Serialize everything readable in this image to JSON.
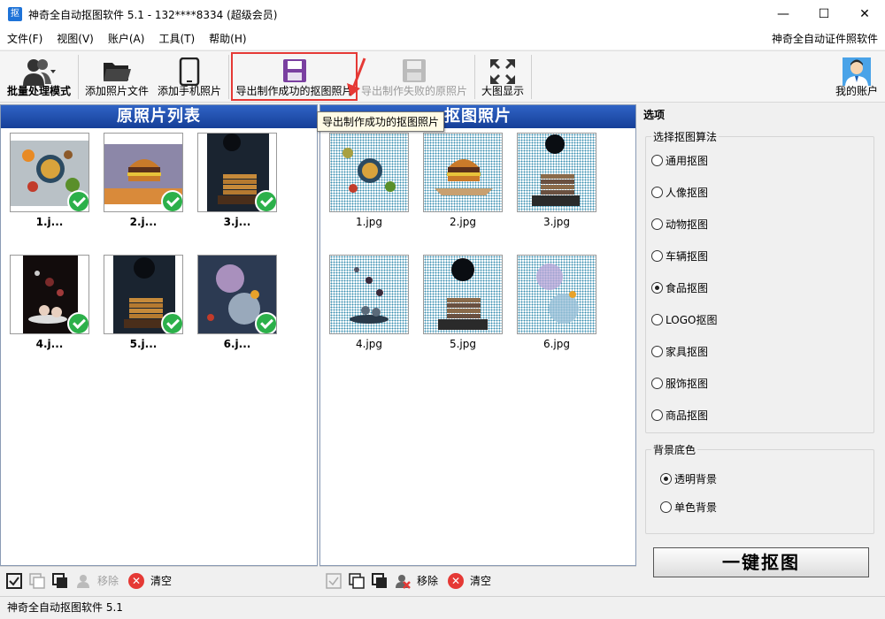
{
  "window": {
    "icon_text": "抠",
    "title": "神奇全自动抠图软件 5.1 - 132****8334 (超级会员)",
    "min": "—",
    "max": "☐",
    "close": "✕"
  },
  "menu": {
    "items": [
      "文件(F)",
      "视图(V)",
      "账户(A)",
      "工具(T)",
      "帮助(H)"
    ],
    "right_link": "神奇全自动证件照软件"
  },
  "toolbar": {
    "batch": "批量处理模式",
    "add_file": "添加照片文件",
    "add_phone": "添加手机照片",
    "export_success": "导出制作成功的抠图照片",
    "export_failed": "导出制作失败的原照片",
    "big_view": "大图显示",
    "account": "我的账户"
  },
  "tooltip": "导出制作成功的抠图照片",
  "left_panel": {
    "title": "原照片列表",
    "items": [
      "1.j...",
      "2.j...",
      "3.j...",
      "4.j...",
      "5.j...",
      "6.j..."
    ]
  },
  "mid_panel": {
    "title": "抠图照片",
    "items": [
      "1.jpg",
      "2.jpg",
      "3.jpg",
      "4.jpg",
      "5.jpg",
      "6.jpg"
    ]
  },
  "bottom": {
    "remove": "移除",
    "clear": "清空"
  },
  "options": {
    "title": "选项",
    "algo_group": "选择抠图算法",
    "algos": [
      "通用抠图",
      "人像抠图",
      "动物抠图",
      "车辆抠图",
      "食品抠图",
      "LOGO抠图",
      "家具抠图",
      "服饰抠图",
      "商品抠图"
    ],
    "selected_algo": "食品抠图",
    "bg_group": "背景底色",
    "bgs": [
      "透明背景",
      "单色背景"
    ],
    "selected_bg": "透明背景",
    "run": "一键抠图"
  },
  "status": "神奇全自动抠图软件 5.1",
  "colors": {
    "header_blue": "#1e4aa8",
    "check_green": "#2cb04a",
    "highlight_red": "#e53935"
  }
}
